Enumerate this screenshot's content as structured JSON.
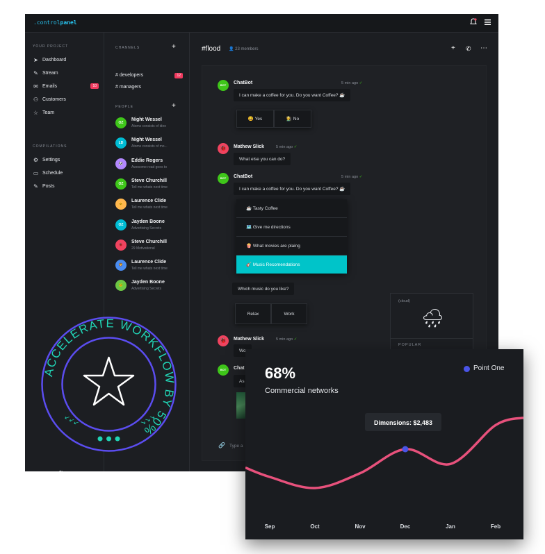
{
  "brand": {
    "prefix": ".control",
    "suffix": "panel"
  },
  "nav": {
    "section1": "YOUR PROJECT",
    "items1": [
      {
        "label": "Dashboard",
        "icon": "send-icon"
      },
      {
        "label": "Stream",
        "icon": "pen-icon"
      },
      {
        "label": "Emails",
        "icon": "mail-icon",
        "badge": "10"
      },
      {
        "label": "Customers",
        "icon": "users-icon"
      },
      {
        "label": "Team",
        "icon": "star-icon"
      }
    ],
    "section2": "COMPILATIONS",
    "items2": [
      {
        "label": "Settings",
        "icon": "gear-icon"
      },
      {
        "label": "Schedule",
        "icon": "calendar-icon"
      },
      {
        "label": "Posts",
        "icon": "pen-icon"
      }
    ]
  },
  "channels": {
    "title": "CHANNELS",
    "items": [
      {
        "label": "developers",
        "badge": "12"
      },
      {
        "label": "managers"
      }
    ]
  },
  "people": {
    "title": "PEOPLE",
    "items": [
      {
        "name": "Night Wessel",
        "sub": "Atoms consists of ideo",
        "initials": "OZ",
        "color": "#3fc61a"
      },
      {
        "name": "Night Wessel",
        "sub": "Atoms consists of mo...",
        "initials": "LD",
        "color": "#00bcd4"
      },
      {
        "name": "Eddie Rogers",
        "sub": "Awesome road goes to",
        "initials": "🐼",
        "color": "#b388ff"
      },
      {
        "name": "Steve Churchill",
        "sub": "Tell me whats next time",
        "initials": "OZ",
        "color": "#3fc61a"
      },
      {
        "name": "Laurence Clide",
        "sub": "Tell me whats next time",
        "initials": "🐱",
        "color": "#ffb74d"
      },
      {
        "name": "Jayden Boone",
        "sub": "Advertising Secrets",
        "initials": "OZ",
        "color": "#00bcd4"
      },
      {
        "name": "Steve Churchill",
        "sub": "29 Motivational",
        "initials": "🐞",
        "color": "#f0435f"
      },
      {
        "name": "Laurence Clide",
        "sub": "Tell me whats next time",
        "initials": "🦁",
        "color": "#4a8cf0"
      },
      {
        "name": "Jayden Boone",
        "sub": "Advertising Secrets",
        "initials": "🐸",
        "color": "#6cc644"
      }
    ]
  },
  "channel": {
    "title": "#flood",
    "members": "23 members"
  },
  "messages": {
    "bot_name": "ChatBot",
    "bot_initials": "BOT",
    "bot_time": "5 min ago",
    "coffee_q": "I can make a coffee for you. Do you want Coffee? ☕",
    "yes": "😀 Yes",
    "no": "🧑‍🌾 No",
    "user_name": "Mathew Slick",
    "user_time": "5 min ago",
    "user_msg": "What else you can do?",
    "menu": [
      "☕ Tasty Coffee",
      "🗺️ Give me directions",
      "🍿 What movies are plaing",
      "🎸 Music Recomendations"
    ],
    "music_q": "Which music do you like?",
    "relax": "Relax",
    "work": "Work",
    "user_msg2": "Wo",
    "bot_partial": "Chat",
    "bot_msg_partial": "As",
    "input_placeholder": "Type a"
  },
  "weather": {
    "label": "(cloud)",
    "section": "POPULAR"
  },
  "chart_card": {
    "percent": "68%",
    "subtitle": "Commercial networks",
    "tooltip": "Dimensions: $2,483",
    "accent": "#e8517c",
    "point_color": "#4a54e8"
  },
  "chart_data": {
    "type": "line",
    "x": [
      "Sep",
      "Oct",
      "Nov",
      "Dec",
      "Jan",
      "Feb"
    ],
    "series": [
      {
        "name": "Point One",
        "values": [
          42,
          30,
          46,
          72,
          56,
          98
        ]
      }
    ],
    "highlight": {
      "x": "Dec",
      "label": "Dimensions: $2,483"
    },
    "ylim": [
      0,
      120
    ],
    "grid": false,
    "legend": "top-right"
  },
  "seal": {
    "text": "ACCELERATE WORKFLOW BY 50%"
  }
}
